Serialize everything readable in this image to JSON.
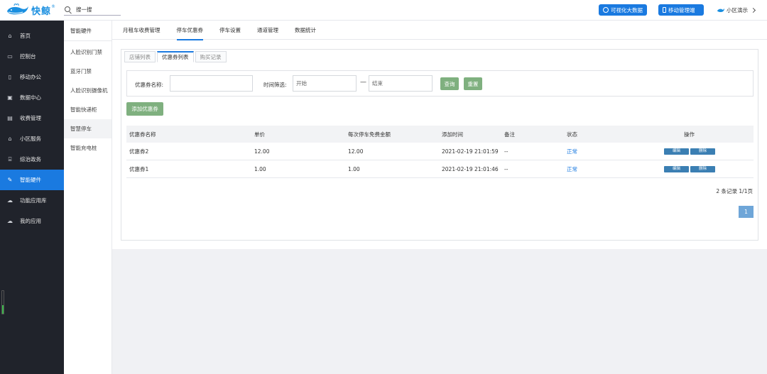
{
  "app": {
    "logo_text": "快鲸",
    "logo_reg": "®"
  },
  "search": {
    "placeholder": "搜一搜"
  },
  "header": {
    "bigdata_label": "可视化大数据",
    "mobile_label": "移动管理端",
    "user_label": "小区演示"
  },
  "sidebar": {
    "items": [
      {
        "label": "首页",
        "icon": "home-icon",
        "glyph": "⌂"
      },
      {
        "label": "控制台",
        "icon": "laptop-icon",
        "glyph": "▭"
      },
      {
        "label": "移动办公",
        "icon": "mobile-icon",
        "glyph": "▯"
      },
      {
        "label": "数据中心",
        "icon": "briefcase-icon",
        "glyph": "▣"
      },
      {
        "label": "收费管理",
        "icon": "card-icon",
        "glyph": "▤"
      },
      {
        "label": "小区服务",
        "icon": "home-icon",
        "glyph": "⌂"
      },
      {
        "label": "综治政务",
        "icon": "bank-icon",
        "glyph": "⌸"
      },
      {
        "label": "智能硬件",
        "icon": "wrench-icon",
        "glyph": "✎"
      },
      {
        "label": "功能应用库",
        "icon": "cloud-download-icon",
        "glyph": "☁"
      },
      {
        "label": "我的应用",
        "icon": "cloud-icon",
        "glyph": "☁"
      }
    ],
    "active_index": 7
  },
  "submenu": {
    "title": "智能硬件",
    "items": [
      "人脸识别门禁",
      "蓝牙门禁",
      "人脸识别摄像机",
      "智能快递柜",
      "智慧停车",
      "智能充电桩"
    ],
    "active_index": 4
  },
  "tabs": [
    "月租车收费管理",
    "停车优惠券",
    "停车设置",
    "通道管理",
    "数据统计"
  ],
  "active_tab": 1,
  "subtabs": [
    "店铺列表",
    "优惠券列表",
    "购买记录"
  ],
  "active_subtab": 1,
  "filter": {
    "name_label": "优惠券名称:",
    "name_value": "",
    "time_label": "时间筛选:",
    "start_placeholder": "开始",
    "end_placeholder": "结束",
    "dash": "—",
    "query_label": "查询",
    "reset_label": "重置"
  },
  "add_label": "添加优惠券",
  "table": {
    "headers": [
      "优惠券名称",
      "单价",
      "每次停车免费金额",
      "添加时间",
      "备注",
      "状态",
      "操作"
    ],
    "rows": [
      {
        "name": "优惠券2",
        "price": "12.00",
        "free": "12.00",
        "time": "2021-02-19 21:01:59",
        "note": "--",
        "status": "正常",
        "edit": "编辑",
        "delete": "删除"
      },
      {
        "name": "优惠券1",
        "price": "1.00",
        "free": "1.00",
        "time": "2021-02-19 21:01:46",
        "note": "--",
        "status": "正常",
        "edit": "编辑",
        "delete": "删除"
      }
    ]
  },
  "summary": "2 条记录 1/1页",
  "pager": {
    "current": "1"
  },
  "colors": {
    "primary": "#1a7ae0",
    "green_button": "#7fb07f",
    "sidebar_bg": "#20232b",
    "action_button": "#3b7fb3"
  }
}
